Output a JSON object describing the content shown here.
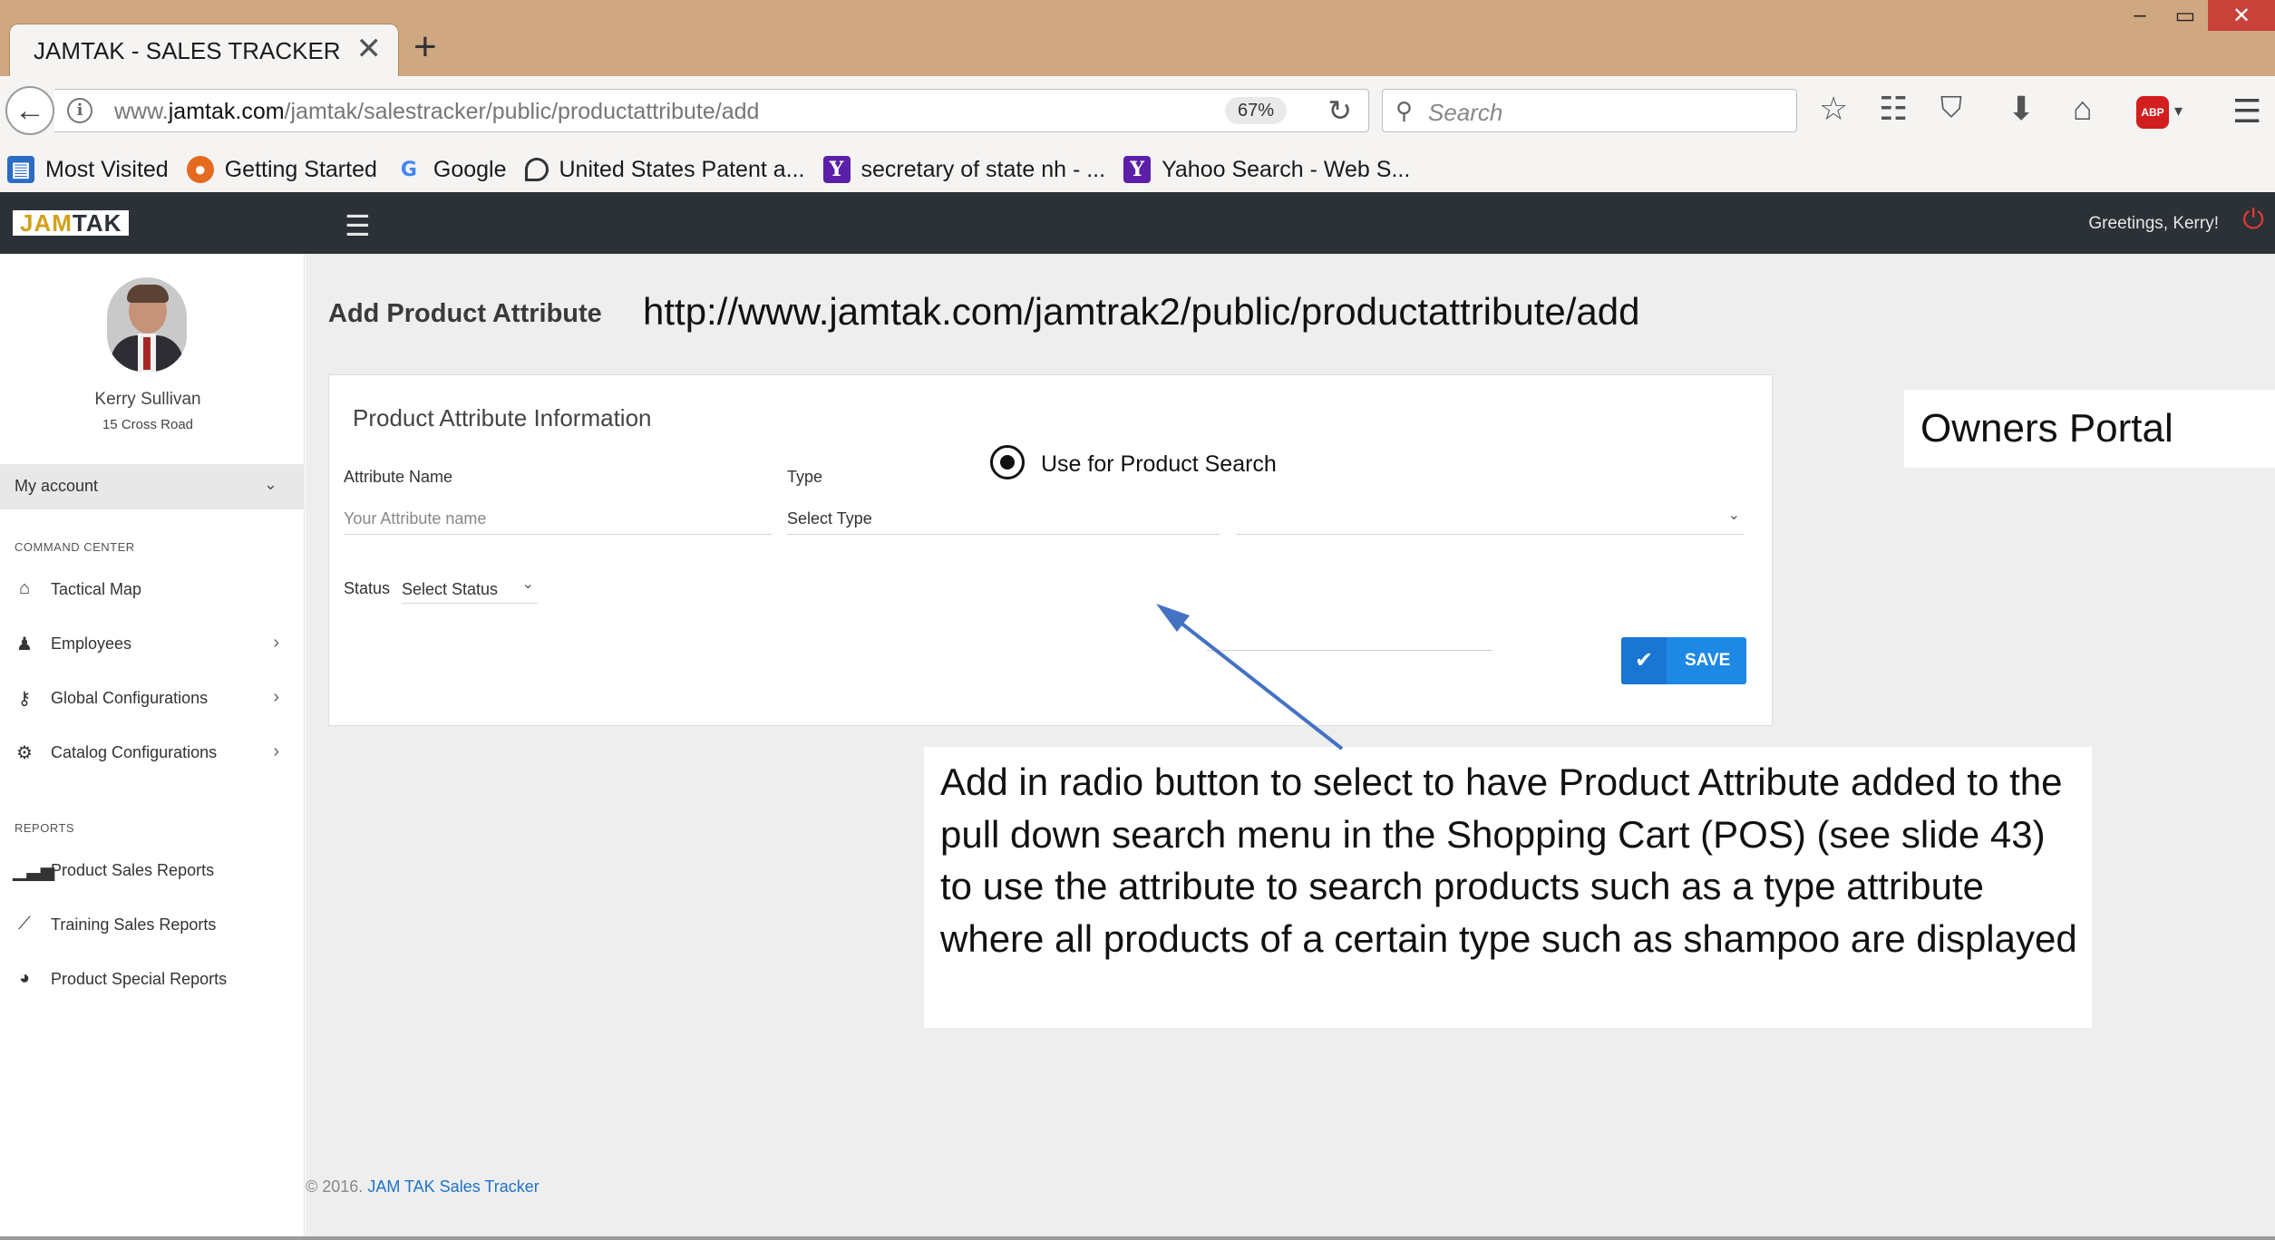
{
  "browser": {
    "tab_title": "JAMTAK - SALES TRACKER",
    "tab_close": "✕",
    "new_tab": "+",
    "window_controls": {
      "minimize": "–",
      "maximize": "▭",
      "close": "✕"
    },
    "url_prefix": "www.",
    "url_domain": "jamtak.com",
    "url_path": "/jamtak/salestracker/public/productattribute/add",
    "zoom": "67%",
    "search_placeholder": "Search",
    "bookmarks": [
      {
        "label": "Most Visited",
        "icon": "most-visited-icon"
      },
      {
        "label": "Getting Started",
        "icon": "firefox-icon"
      },
      {
        "label": "Google",
        "icon": "google-icon"
      },
      {
        "label": "United States Patent a...",
        "icon": "patent-office-icon"
      },
      {
        "label": "secretary of state nh - ...",
        "icon": "yahoo-icon"
      },
      {
        "label": "Yahoo Search - Web S...",
        "icon": "yahoo-icon"
      }
    ]
  },
  "app": {
    "logo_a": "JAM",
    "logo_b": "TAK",
    "greeting": "Greetings, Kerry!"
  },
  "sidebar": {
    "user_name": "Kerry Sullivan",
    "user_address": "15 Cross Road",
    "my_account": "My account",
    "section_command": "COMMAND CENTER",
    "section_reports": "REPORTS",
    "command_items": [
      {
        "label": "Tactical Map",
        "icon": "home-icon",
        "has_arrow": false
      },
      {
        "label": "Employees",
        "icon": "user-icon",
        "has_arrow": true
      },
      {
        "label": "Global Configurations",
        "icon": "key-icon",
        "has_arrow": true
      },
      {
        "label": "Catalog Configurations",
        "icon": "gear-icon",
        "has_arrow": true
      }
    ],
    "report_items": [
      {
        "label": "Product Sales Reports",
        "icon": "bar-chart-icon"
      },
      {
        "label": "Training Sales Reports",
        "icon": "line-chart-icon"
      },
      {
        "label": "Product Special Reports",
        "icon": "pie-chart-icon"
      }
    ]
  },
  "main": {
    "page_title": "Add Product Attribute",
    "url_note": "http://www.jamtak.com/jamtrak2/public/productattribute/add",
    "owners_portal": "Owners Portal",
    "card_title": "Product Attribute Information",
    "attribute_name_label": "Attribute Name",
    "attribute_name_placeholder": "Your Attribute name",
    "type_label": "Type",
    "type_value": "Select Type",
    "status_label": "Status",
    "status_value": "Select Status",
    "radio_label": "Use for Product Search",
    "radio_selected": true,
    "save_label": "SAVE",
    "note": "Add in radio button to select to have Product Attribute added to the pull down search menu in the Shopping Cart (POS) (see slide 43) to use the attribute to search products such as a type attribute where all products of a certain type such as shampoo are displayed",
    "footer_prefix": "© 2016.",
    "footer_link": "JAM TAK Sales Tracker"
  },
  "colors": {
    "accent": "#1e88e5",
    "header_bg": "#2b3136",
    "browser_chrome": "#cfa882",
    "annotation_arrow": "#4472c4"
  }
}
